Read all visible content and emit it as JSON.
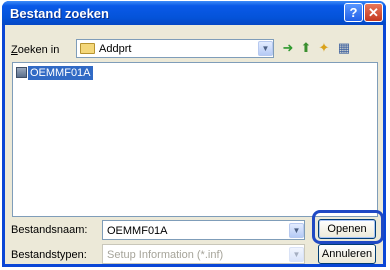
{
  "window": {
    "title": "Bestand zoeken"
  },
  "titlebar_buttons": {
    "help": "?",
    "close": "✕"
  },
  "look_in": {
    "label": "Zoeken in",
    "value": "Addprt"
  },
  "files": [
    {
      "name": "OEMMF01A"
    }
  ],
  "filename": {
    "label": "Bestandsnaam:",
    "value": "OEMMF01A"
  },
  "filetype": {
    "label": "Bestandstypen:",
    "value": "Setup Information (*.inf)"
  },
  "buttons": {
    "open": "Openen",
    "cancel": "Annuleren"
  },
  "colors": {
    "titlebar": "#0453d9",
    "selection": "#316ac5",
    "highlight_ring": "#1f49c4"
  }
}
